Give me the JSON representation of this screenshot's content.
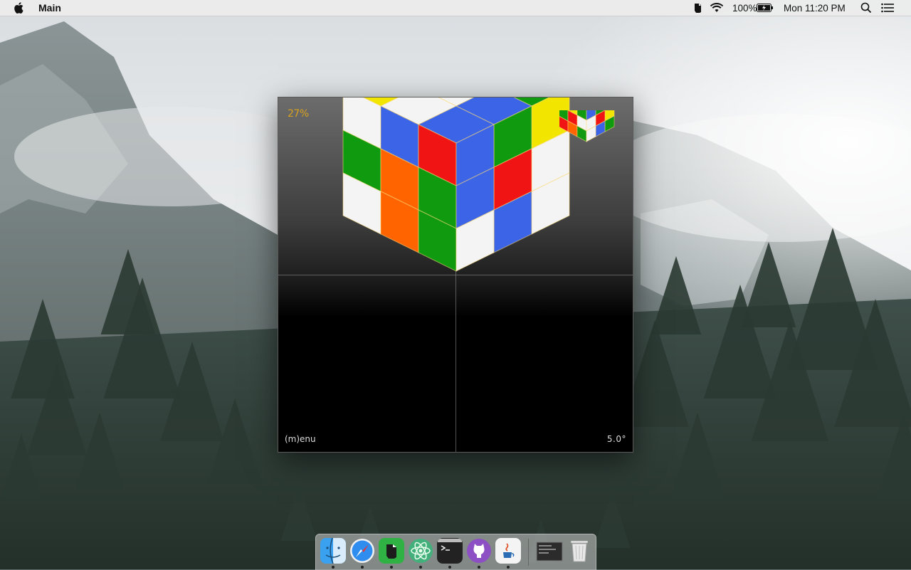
{
  "menubar": {
    "app_name": "Main",
    "battery_text": "100%",
    "clock": "Mon 11:20 PM",
    "status_icons": [
      "evernote-icon",
      "wifi-icon",
      "battery-icon",
      "spotlight-search-icon",
      "notification-center-icon"
    ]
  },
  "window": {
    "progress": "27%",
    "menu_hint": "(m)enu",
    "rotation_angle": "5.0°"
  },
  "cube": {
    "view": "corner view, top / left / right faces",
    "top_face": [
      [
        "#ff5a00",
        "#ff1010",
        "#ffd000"
      ],
      [
        "#ff1010",
        "#ffffff",
        "#ffe800"
      ],
      [
        "#2aa52a",
        "#3c63e6",
        "#ffffff"
      ]
    ],
    "colors": {
      "red": "#f01414",
      "orange": "#ff6400",
      "yellow": "#f2e600",
      "green": "#0f9a0f",
      "blue": "#3c64e6",
      "white": "#f4f4f4"
    }
  },
  "dock": {
    "apps": [
      {
        "name": "finder-icon",
        "running": true
      },
      {
        "name": "safari-icon",
        "running": true
      },
      {
        "name": "evernote-icon",
        "running": true
      },
      {
        "name": "atom-icon",
        "running": true
      },
      {
        "name": "terminal-icon",
        "running": true
      },
      {
        "name": "github-desktop-icon",
        "running": true
      },
      {
        "name": "java-icon",
        "running": true
      },
      {
        "name": "window-thumbnail-icon",
        "running": false
      },
      {
        "name": "trash-icon",
        "running": false
      }
    ]
  }
}
